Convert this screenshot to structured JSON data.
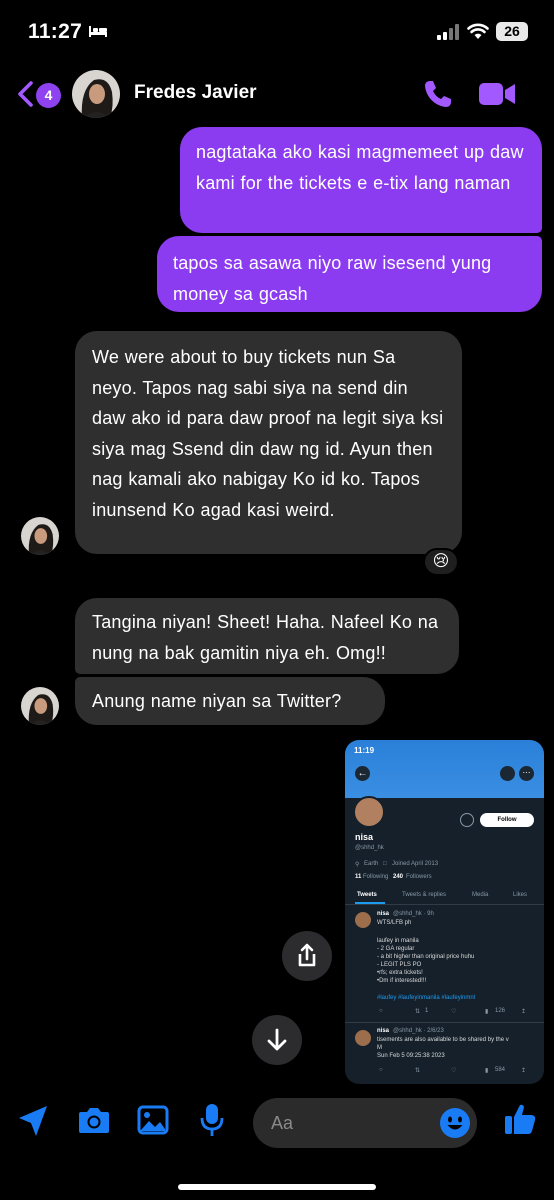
{
  "status_bar": {
    "time": "11:27",
    "battery": "26"
  },
  "header": {
    "badge_count": "4",
    "contact_name": "Fredes Javier"
  },
  "messages": [
    {
      "from": "me",
      "text": "nagtataka ako kasi magmemeet up daw kami for the tickets e e-tix lang naman"
    },
    {
      "from": "me",
      "text": "tapos sa asawa niyo raw isesend yung money sa gcash"
    },
    {
      "from": "them",
      "text": "We were about to buy tickets nun Sa neyo. Tapos nag sabi siya na send din daw ako id para daw proof na legit siya ksi siya mag Ssend din daw ng id. Ayun then nag kamali ako nabigay Ko id ko. Tapos inunsend Ko agad kasi weird.",
      "reaction": "😢"
    },
    {
      "from": "them",
      "text": "Tangina niyan! Sheet! Haha. Nafeel Ko na nung na bak gamitin niya eh. Omg!!"
    },
    {
      "from": "them",
      "text": "Anung name niyan sa Twitter?"
    }
  ],
  "shared_image": {
    "time": "11:19",
    "follow_label": "Follow",
    "name": "nisa",
    "handle": "@shhd_hk",
    "location": "Earth",
    "joined": "Joined April 2013",
    "following_count": "11",
    "following_label": "Following",
    "followers_count": "240",
    "followers_label": "Followers",
    "tabs": [
      "Tweets",
      "Tweets & replies",
      "Media",
      "Likes"
    ],
    "tweet1": {
      "author": "nisa",
      "meta": "@shhd_hk · 9h",
      "lines": [
        "WTS/LFB  ph",
        "",
        "laufey in manila",
        "- 2 GA regular",
        "- a bit higher than original price huhu",
        "- LEGIT PLS PO",
        "•rfs; extra tickets!",
        "•Dm if interested!!!"
      ],
      "hashtags": "#laufey #laufeyinmanila #laufeyinmnl",
      "retweets": "1",
      "views": "126"
    },
    "tweet2": {
      "author": "nisa",
      "meta": "@shhd_hk · 2/6/23",
      "lines": [
        "tisements are also available to be shared by the v",
        "M",
        "Sun Feb  5 09:25:38 2023"
      ],
      "views": "584"
    }
  },
  "composer": {
    "placeholder": "Aa"
  },
  "colors": {
    "accent": "#8c3cf0",
    "icon_blue": "#1a7cf5",
    "incoming_bubble": "#2f2f2f"
  }
}
